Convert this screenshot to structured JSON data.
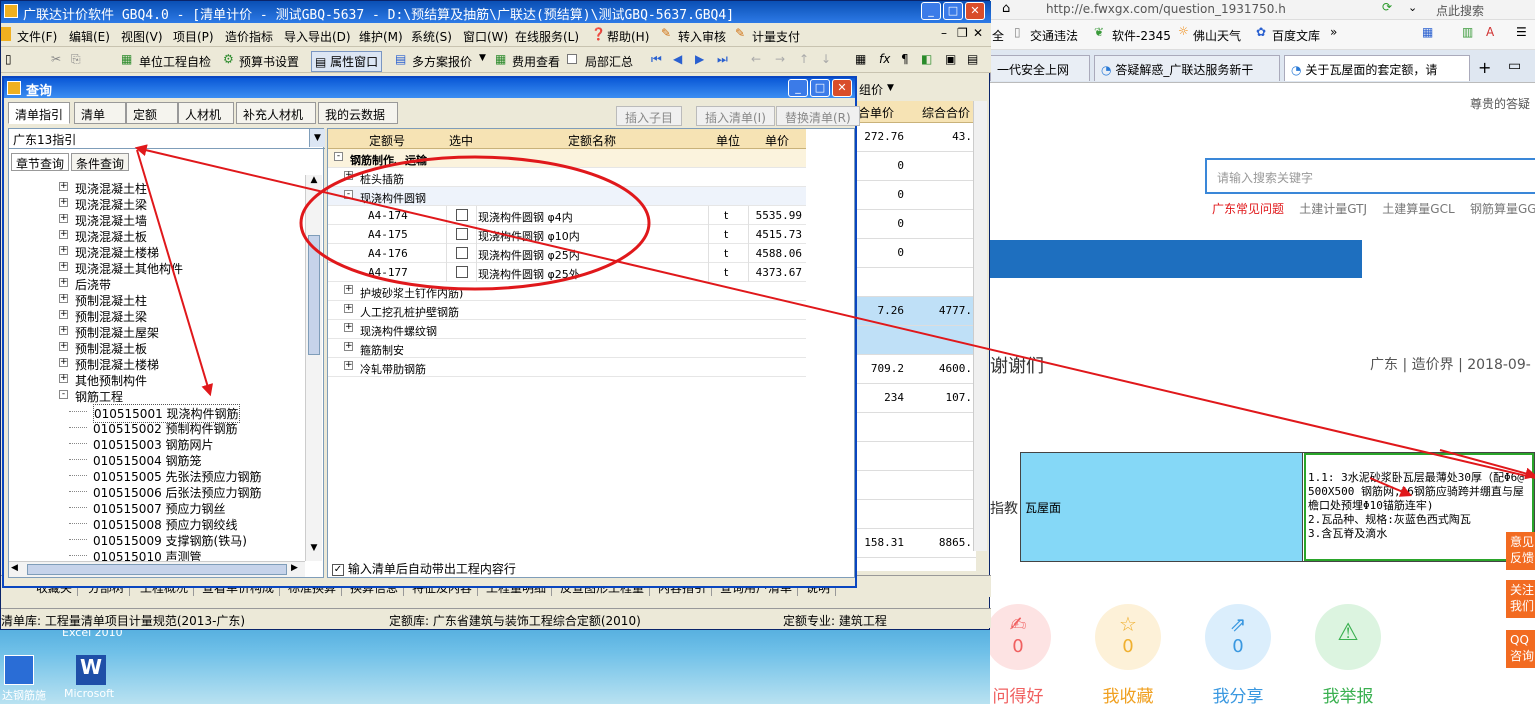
{
  "app_title": "广联达计价软件 GBQ4.0 - [清单计价 - 测试GBQ-5637 - D:\\预结算及抽筋\\广联达(预结算)\\测试GBQ-5637.GBQ4]",
  "menu": [
    "文件(F)",
    "编辑(E)",
    "视图(V)",
    "项目(P)",
    "造价指标",
    "导入导出(D)",
    "维护(M)",
    "系统(S)",
    "窗口(W)",
    "在线服务(L)",
    "帮助(H)",
    "转入审核",
    "计量支付"
  ],
  "toolbar": [
    "单位工程自检",
    "预算书设置",
    "属性窗口",
    "多方案报价",
    "费用查看",
    "局部汇总"
  ],
  "grid_headers": [
    "合单价",
    "综合合价"
  ],
  "grid_values": [
    [
      "272.76",
      "43."
    ],
    [
      "0",
      ""
    ],
    [
      "0",
      ""
    ],
    [
      "0",
      ""
    ],
    [
      "0",
      ""
    ],
    [
      "",
      ""
    ],
    [
      "7.26",
      "4777."
    ],
    [
      "",
      ""
    ],
    [
      "709.2",
      "4600."
    ],
    [
      "234",
      "107."
    ],
    [
      "",
      ""
    ],
    [
      "",
      ""
    ],
    [
      "",
      ""
    ],
    [
      "",
      ""
    ],
    [
      "158.31",
      "8865."
    ]
  ],
  "right_grid_label": "组价",
  "bottom_tabs": [
    "收藏夹",
    "分部树",
    "工程概况",
    "查看单价构成",
    "标准换算",
    "换算信息",
    "特征及内容",
    "工程量明细",
    "反查图形工程量",
    "内容指引",
    "查询用户清单",
    "说明"
  ],
  "status": {
    "qd": "清单库: 工程量清单项目计量规范(2013-广东)",
    "de": "定额库: 广东省建筑与装饰工程综合定额(2010)",
    "zy": "定额专业: 建筑工程"
  },
  "dialog": {
    "title": "查询",
    "tabs": [
      "清单指引",
      "清单",
      "定额",
      "人材机",
      "补充人材机",
      "我的云数据"
    ],
    "buttons": [
      "插入子目",
      "插入清单(I)",
      "替换清单(R)"
    ],
    "combo_value": "广东13指引",
    "subtabs": [
      "章节查询",
      "条件查询"
    ],
    "tree": [
      {
        "t": "现浇混凝土柱",
        "lvl": 1,
        "exp": "+"
      },
      {
        "t": "现浇混凝土梁",
        "lvl": 1,
        "exp": "+"
      },
      {
        "t": "现浇混凝土墙",
        "lvl": 1,
        "exp": "+"
      },
      {
        "t": "现浇混凝土板",
        "lvl": 1,
        "exp": "+"
      },
      {
        "t": "现浇混凝土楼梯",
        "lvl": 1,
        "exp": "+"
      },
      {
        "t": "现浇混凝土其他构件",
        "lvl": 1,
        "exp": "+"
      },
      {
        "t": "后浇带",
        "lvl": 1,
        "exp": "+"
      },
      {
        "t": "预制混凝土柱",
        "lvl": 1,
        "exp": "+"
      },
      {
        "t": "预制混凝土梁",
        "lvl": 1,
        "exp": "+"
      },
      {
        "t": "预制混凝土屋架",
        "lvl": 1,
        "exp": "+"
      },
      {
        "t": "预制混凝土板",
        "lvl": 1,
        "exp": "+"
      },
      {
        "t": "预制混凝土楼梯",
        "lvl": 1,
        "exp": "+"
      },
      {
        "t": "其他预制构件",
        "lvl": 1,
        "exp": "+"
      },
      {
        "t": "钢筋工程",
        "lvl": 1,
        "exp": "-"
      },
      {
        "t": "010515001   现浇构件钢筋",
        "lvl": 2,
        "exp": "",
        "sel": true
      },
      {
        "t": "010515002   预制构件钢筋",
        "lvl": 2,
        "exp": ""
      },
      {
        "t": "010515003   钢筋网片",
        "lvl": 2,
        "exp": ""
      },
      {
        "t": "010515004   钢筋笼",
        "lvl": 2,
        "exp": ""
      },
      {
        "t": "010515005   先张法预应力钢筋",
        "lvl": 2,
        "exp": ""
      },
      {
        "t": "010515006   后张法预应力钢筋",
        "lvl": 2,
        "exp": ""
      },
      {
        "t": "010515007   预应力钢丝",
        "lvl": 2,
        "exp": ""
      },
      {
        "t": "010515008   预应力钢绞线",
        "lvl": 2,
        "exp": ""
      },
      {
        "t": "010515009   支撑钢筋(铁马)",
        "lvl": 2,
        "exp": ""
      },
      {
        "t": "010515010   声测管",
        "lvl": 2,
        "exp": ""
      }
    ],
    "headers": [
      "定额号",
      "选中",
      "定额名称",
      "单位",
      "单价"
    ],
    "rows": [
      {
        "type": "grp",
        "exp": "-",
        "name": "钢筋制作、运输"
      },
      {
        "type": "grp2",
        "exp": "+",
        "name": "桩头插筋"
      },
      {
        "type": "sub",
        "exp": "-",
        "name": "现浇构件圆钢"
      },
      {
        "type": "item",
        "code": "A4-174",
        "name": "现浇构件圆钢  φ4内",
        "unit": "t",
        "price": "5535.99"
      },
      {
        "type": "item",
        "code": "A4-175",
        "name": "现浇构件圆钢  φ10内",
        "unit": "t",
        "price": "4515.73"
      },
      {
        "type": "item",
        "code": "A4-176",
        "name": "现浇构件圆钢  φ25内",
        "unit": "t",
        "price": "4588.06"
      },
      {
        "type": "item",
        "code": "A4-177",
        "name": "现浇构件圆钢  φ25外",
        "unit": "t",
        "price": "4373.67"
      },
      {
        "type": "grp2",
        "exp": "+",
        "name": "护坡砂浆土钉作内筋)"
      },
      {
        "type": "grp2",
        "exp": "+",
        "name": "人工挖孔桩护壁钢筋"
      },
      {
        "type": "grp2",
        "exp": "+",
        "name": "现浇构件螺纹钢"
      },
      {
        "type": "grp2",
        "exp": "+",
        "name": "箍筋制安"
      },
      {
        "type": "grp2",
        "exp": "+",
        "name": "冷轧带肋钢筋"
      }
    ],
    "checkbox_label": "输入清单后自动带出工程内容行"
  },
  "browser": {
    "url": "http://e.fwxgx.com/question_1931750.h",
    "search_hint": "点此搜索",
    "bookmarks": [
      "全",
      "交通违法",
      "软件-2345",
      "佛山天气",
      "百度文库"
    ],
    "tabs": [
      "一代安全上网",
      "答疑解惑_广联达服务新干",
      "关于瓦屋面的套定额，请"
    ],
    "greeting": "尊贵的答疑",
    "search_placeholder": "请输入搜索关键字",
    "links": [
      "广东常见问题",
      "土建计量GTJ",
      "土建算量GCL",
      "钢筋算量GG"
    ],
    "meta": "广东 | 造价界 | 2018-09-",
    "heading_frag": "谢谢们",
    "table_left_frag": "指教",
    "table_cell1": "瓦屋面",
    "table_cell2": [
      "1.1: 3水泥砂浆卧瓦层最薄处30厚（配Φ6@",
      "500X500 钢筋网,Φ6钢筋应骑跨并绷直与屋",
      "檐口处预埋Φ10锚筋连牢)",
      "2.瓦品种、规格:灰蓝色西式陶瓦",
      "3.含瓦脊及滴水"
    ],
    "actions": [
      {
        "label": "问得好",
        "count": "0"
      },
      {
        "label": "我收藏",
        "count": "0"
      },
      {
        "label": "我分享",
        "count": "0"
      },
      {
        "label": "我举报",
        "count": ""
      }
    ],
    "side": [
      [
        "意见",
        "反馈"
      ],
      [
        "关注",
        "我们"
      ],
      [
        "QQ",
        "咨询"
      ]
    ]
  },
  "desktop": {
    "icon1": "达钢筋施",
    "icon2": "Microsoft",
    "taskbar_frag": "Excel 2010"
  }
}
